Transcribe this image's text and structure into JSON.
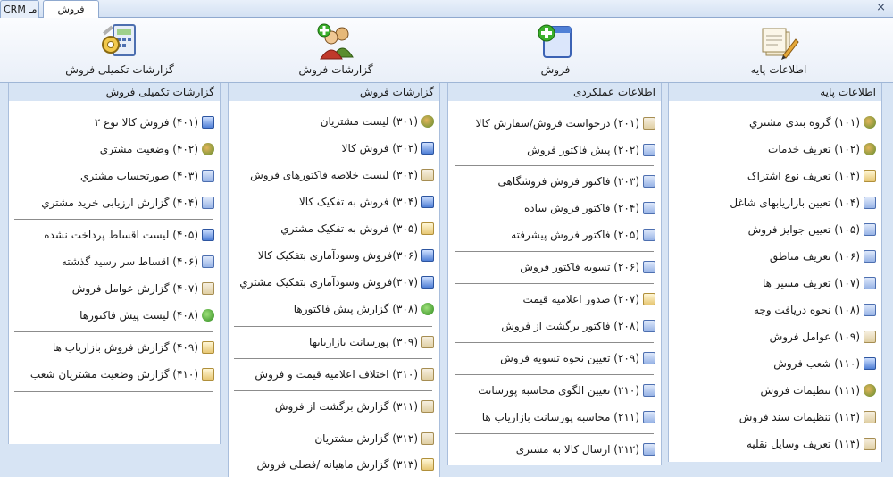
{
  "tabs": {
    "crm": "CRM مـ",
    "sales": "فروش",
    "close": "×"
  },
  "ribbon": [
    {
      "label": "اطلاعات پایه",
      "icon": "documents-pencil-icon"
    },
    {
      "label": "فروش",
      "icon": "window-add-icon"
    },
    {
      "label": "گزارشات فروش",
      "icon": "users-add-icon"
    },
    {
      "label": "گزارشات تکمیلی فروش",
      "icon": "calculator-gear-icon"
    }
  ],
  "panels": {
    "base": {
      "title": "اطلاعات پایه",
      "items": [
        "(۱۰۱) گروه بندی مشتري",
        "(۱۰۲) تعریف خدمات",
        "(۱۰۳) تعریف نوع اشتراک",
        "(۱۰۴) تعیین بازاریابهای شاغل",
        "(۱۰۵) تعیین جوایز فروش",
        "(۱۰۶) تعریف مناطق",
        "(۱۰۷) تعریف مسیر ها",
        "(۱۰۸) نحوه دریافت وجه",
        "(۱۰۹) عوامل فروش",
        "(۱۱۰) شعب  فروش",
        "(۱۱۱) تنظیمات فروش",
        "(۱۱۲) تنظیمات سند فروش",
        "(۱۱۳) تعریف وسایل نقلیه"
      ]
    },
    "perf": {
      "title": "اطلاعات عملکردی",
      "items": [
        "(۲۰۱) درخواست فروش/سفارش کالا",
        "(۲۰۲) پیش فاکتور فروش",
        "(۲۰۳) فاکتور فروش فروشگاهی",
        "(۲۰۴) فاکتور فروش ساده",
        "(۲۰۵) فاکتور فروش پیشرفته",
        "(۲۰۶) تسویه فاکتور فروش",
        "(۲۰۷) صدور اعلامیه قیمت",
        "(۲۰۸) فاکتور برگشت از فروش",
        "(۲۰۹) تعیین نحوه تسویه فروش",
        "(۲۱۰) تعیین الگوی محاسبه پورسانت",
        "(۲۱۱) محاسبه پورسانت بازاریاب ها",
        "(۲۱۲) ارسال کالا به مشتری"
      ]
    },
    "reports": {
      "title": "گزارشات فروش",
      "items": [
        "(۳۰۱) لیست مشتریان",
        "(۳۰۲) فروش کالا",
        "(۳۰۳) لیست خلاصه فاکتورهای فروش",
        "(۳۰۴) فروش به تفکیک کالا",
        "(۳۰۵) فروش به تفکیک مشتري",
        "(۳۰۶)فروش وسودآماری بتفکیک کالا",
        "(۳۰۷)فروش وسودآماری بتفکیک مشتري",
        "(۳۰۸) گزارش پیش فاکتورها",
        "(۳۰۹) پورسانت بازاریابها",
        "(۳۱۰) اختلاف اعلامیه قیمت و فروش",
        "(۳۱۱) گزارش برگشت از فروش",
        "(۳۱۲) گزارش مشتریان",
        "(۳۱۳) گزارش ماهیانه /فصلی فروش"
      ]
    },
    "extra": {
      "title": "گزارشات تکمیلی فروش",
      "items": [
        "(۴۰۱) فروش کالا نوع ۲",
        "(۴۰۲) وضعیت مشتري",
        "(۴۰۳) صورتحساب مشتري",
        "(۴۰۴) گزارش ارزیابی خرید مشتري",
        "(۴۰۵) لیست اقساط پرداخت نشده",
        "(۴۰۶) اقساط سر رسید گذشته",
        "(۴۰۷) گزارش عوامل فروش",
        "(۴۰۸) لیست پیش فاکتورها",
        "(۴۰۹) گزارش فروش بازاریاب ها",
        "(۴۱۰) گزارش وضعیت مشتریان شعب"
      ]
    }
  }
}
